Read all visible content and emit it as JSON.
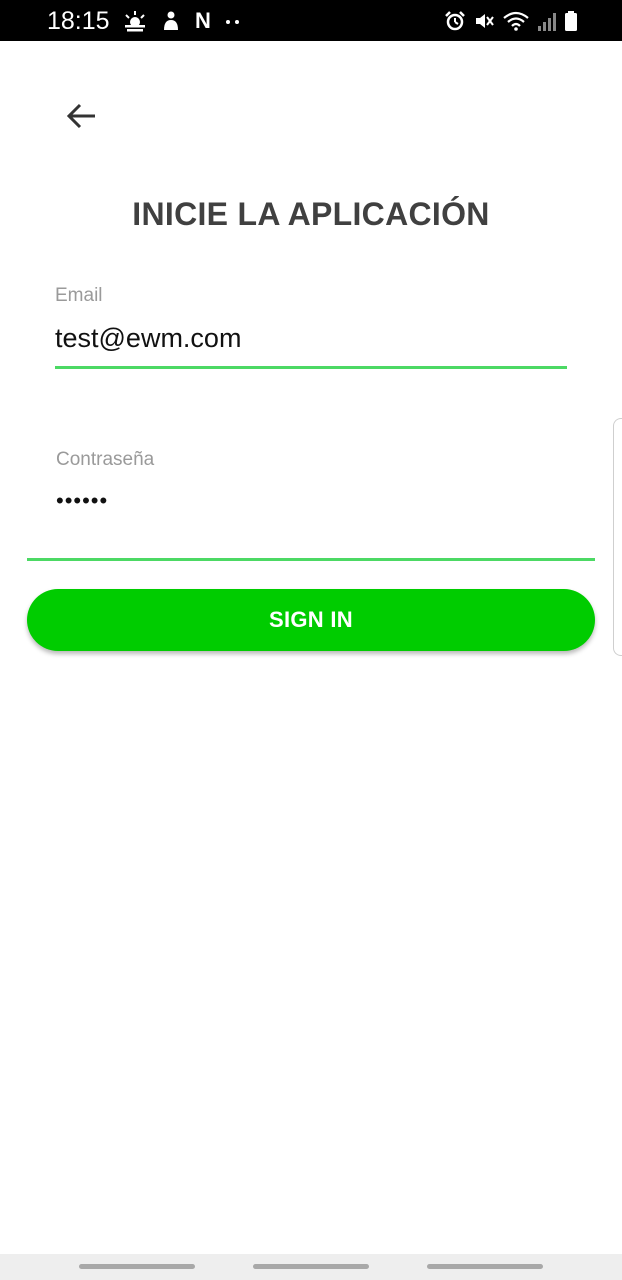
{
  "status_bar": {
    "time": "18:15",
    "left_icons": [
      "weather-icon",
      "cast-icon",
      "netflix-icon",
      "more-dots-icon"
    ],
    "netflix_glyph": "N",
    "right_icons": [
      "alarm-icon",
      "mute-icon",
      "wifi-icon",
      "signal-icon",
      "battery-icon"
    ]
  },
  "header": {
    "back_icon": "arrow-left-icon",
    "title": "INICIE LA APLICACIÓN"
  },
  "form": {
    "email": {
      "label": "Email",
      "value": "test@ewm.com"
    },
    "password": {
      "label": "Contraseña",
      "masked_value": "••••••"
    },
    "sign_in_label": "SIGN IN"
  },
  "colors": {
    "accent": "#4cd964",
    "button": "#00cc00",
    "title": "#404040",
    "label": "#9a9a9a"
  }
}
